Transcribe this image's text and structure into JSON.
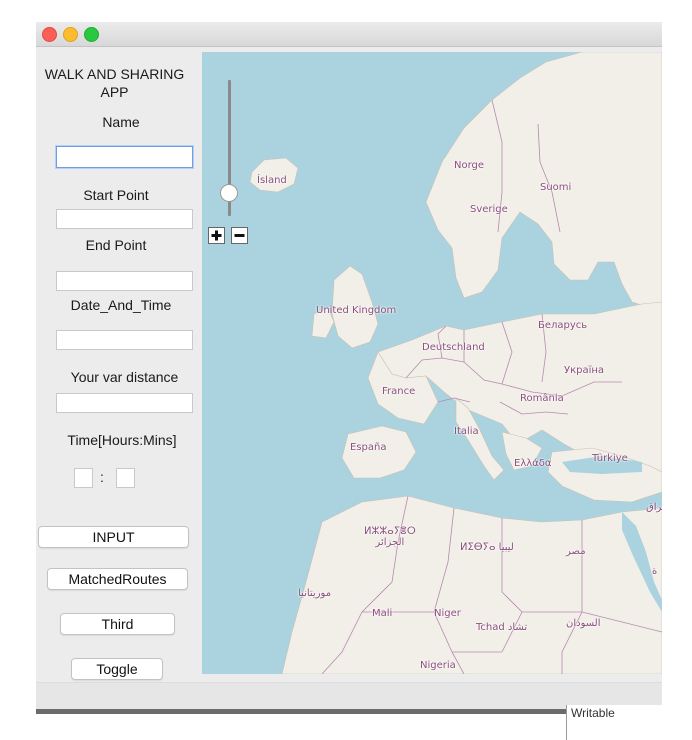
{
  "app_title": "WALK AND SHARING APP",
  "form": {
    "name_label": "Name",
    "name_value": "",
    "start_label": "Start Point",
    "start_value": "",
    "end_label": "End Point",
    "end_value": "",
    "datetime_label": "Date_And_Time",
    "datetime_value": "",
    "distance_label": "Your var distance",
    "distance_value": "",
    "time_label": "Time[Hours:Mins]",
    "hours_value": "",
    "time_separator": ":",
    "mins_value": ""
  },
  "buttons": {
    "input": "INPUT",
    "matched_routes": "MatchedRoutes",
    "third": "Third",
    "toggle": "Toggle"
  },
  "map": {
    "zoom_in": "+",
    "zoom_out": "−",
    "zoom_level": 0.45,
    "water_color": "#aad3df",
    "land_color": "#f2efe9",
    "border_color": "#b58ab0",
    "labels": {
      "iceland": "Ísland",
      "norway": "Norge",
      "sweden": "Sverige",
      "finland": "Suomi",
      "uk": "United Kingdom",
      "belarus": "Беларусь",
      "germany": "Deutschland",
      "ukraine": "Україна",
      "france": "France",
      "romania": "România",
      "italy": "Italia",
      "spain": "España",
      "greece": "Ελλάδα",
      "turkey": "Türkiye",
      "iraq": "عراق",
      "algeria": "ⵍⵣⵣⴰⵢⴻⵔ\nالجزائر",
      "libya": "ⵍⵉⴱⵢⴰ ليبيا",
      "egypt": "مصر",
      "saudi": "ة",
      "mauritania": "موريتانيا",
      "mali": "Mali",
      "niger": "Niger",
      "chad": "Tchad تشاد",
      "sudan": "السودان",
      "nigeria": "Nigeria"
    }
  },
  "status": {
    "writable": "Writable"
  }
}
